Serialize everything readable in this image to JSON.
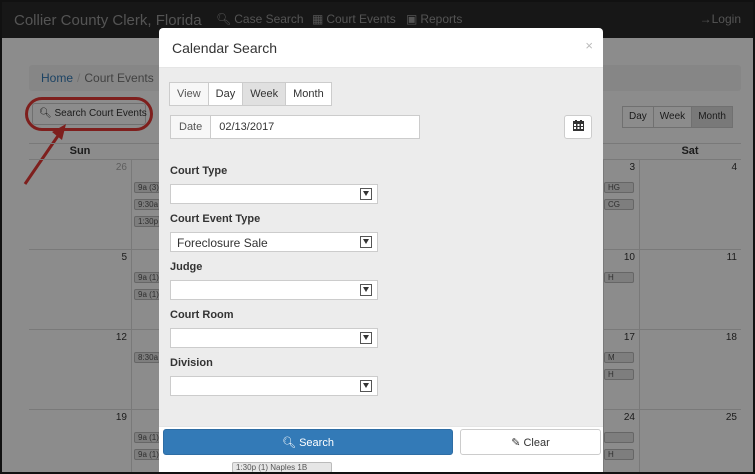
{
  "navbar": {
    "brand": "Collier County Clerk, Florida",
    "links": [
      {
        "label": "Case Search",
        "icon": "search-icon"
      },
      {
        "label": "Court Events",
        "icon": "calendar-icon"
      },
      {
        "label": "Reports",
        "icon": "folder-icon"
      }
    ],
    "login_label": "Login"
  },
  "breadcrumb": {
    "home": "Home",
    "separator": "/",
    "current": "Court Events"
  },
  "search_button": {
    "label": "Search Court Events"
  },
  "view_buttons": [
    {
      "label": "Day",
      "active": false
    },
    {
      "label": "Week",
      "active": false
    },
    {
      "label": "Month",
      "active": true
    }
  ],
  "calendar": {
    "headers": {
      "sun": "Sun",
      "sat": "Sat"
    },
    "rows": [
      {
        "sun": "26",
        "thu": "3",
        "sat": "4",
        "events_left": [
          "9a (3)",
          "9:30a",
          "1:30p"
        ],
        "events_right": [
          "HG",
          "CG"
        ]
      },
      {
        "sun": "5",
        "thu": "10",
        "sat": "11",
        "events_left": [
          "9a (1)",
          "9a (1)"
        ],
        "events_right": [
          "H"
        ]
      },
      {
        "sun": "12",
        "thu": "17",
        "sat": "18",
        "events_left": [
          "8:30a"
        ],
        "events_right": [
          "M",
          "H"
        ]
      },
      {
        "sun": "19",
        "thu": "24",
        "sat": "25",
        "events_left": [
          "9a (1)",
          "9a (1)"
        ],
        "events_right": [
          "",
          "H"
        ],
        "bottom_event": "1:30p (1) Naples 1B"
      }
    ]
  },
  "modal": {
    "title": "Calendar Search",
    "close": "×",
    "view_group": {
      "label": "View",
      "options": [
        "Day",
        "Week",
        "Month"
      ],
      "active": "Week"
    },
    "date": {
      "label": "Date",
      "value": "02/13/2017"
    },
    "fields": [
      {
        "label": "Court Type",
        "value": ""
      },
      {
        "label": "Court Event Type",
        "value": "Foreclosure Sale"
      },
      {
        "label": "Judge",
        "value": ""
      },
      {
        "label": "Court Room",
        "value": ""
      },
      {
        "label": "Division",
        "value": ""
      }
    ],
    "search_label": "Search",
    "clear_label": "Clear"
  },
  "colors": {
    "navbar": "#2a2a2a",
    "primary": "#337ab7",
    "highlight": "#e53935"
  }
}
